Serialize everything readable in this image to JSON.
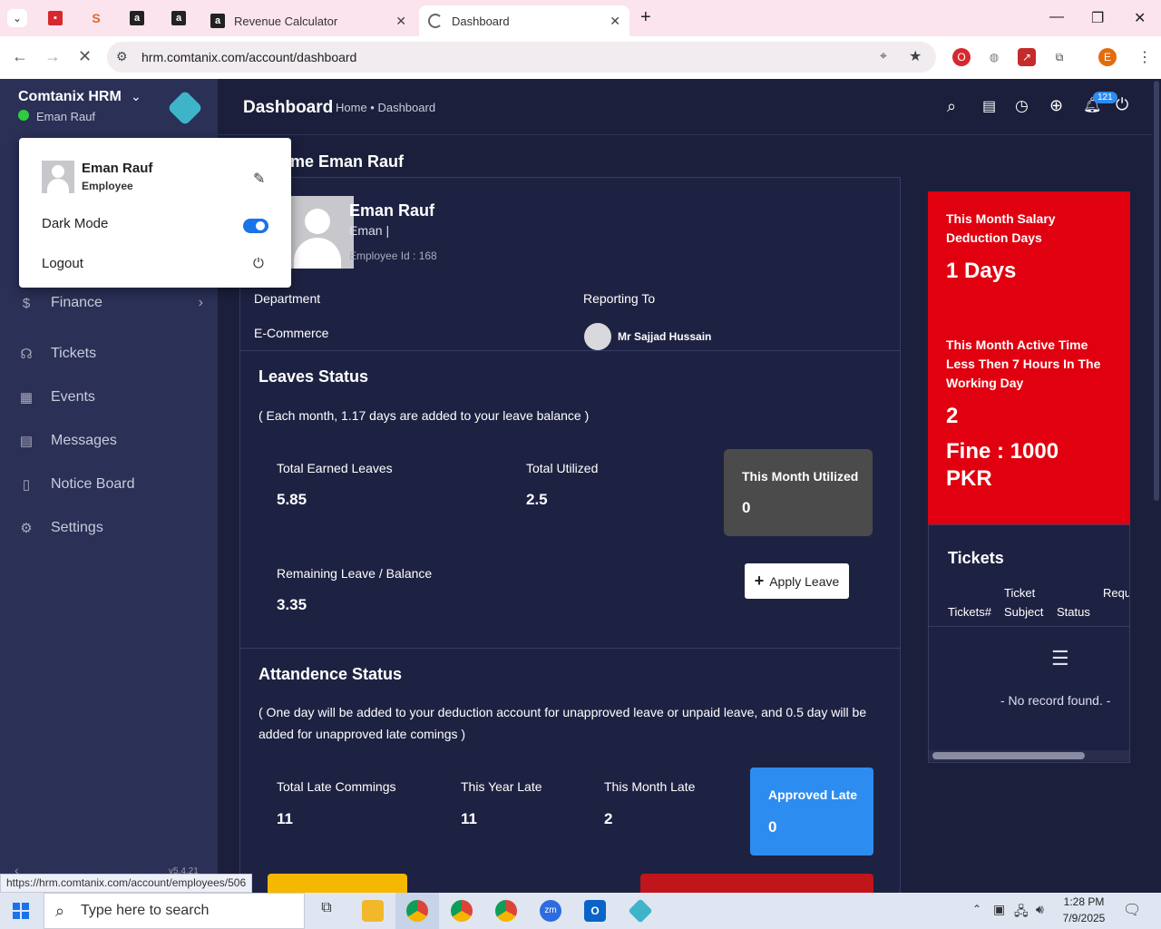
{
  "browser": {
    "tabs": [
      {
        "title": "Revenue Calculator",
        "active": false
      },
      {
        "title": "Dashboard",
        "active": true
      }
    ],
    "url": "hrm.comtanix.com/account/dashboard",
    "status_url": "https://hrm.comtanix.com/account/employees/506",
    "profile_initial": "E",
    "pinned_icons": [
      "red-app-icon",
      "stackby-icon",
      "amazon-a-icon",
      "amazon-a-icon"
    ]
  },
  "app": {
    "brand": "Comtanix HRM",
    "user_name": "Eman Rauf",
    "header_title": "Dashboard",
    "breadcrumb": "Home • Dashboard",
    "notification_count": "121",
    "version": "v5.4.21",
    "sidebar_items": [
      {
        "label": "Finance",
        "icon": "dollar-icon"
      },
      {
        "label": "Tickets",
        "icon": "headset-icon"
      },
      {
        "label": "Events",
        "icon": "calendar-icon"
      },
      {
        "label": "Messages",
        "icon": "message-icon"
      },
      {
        "label": "Notice Board",
        "icon": "clipboard-icon"
      },
      {
        "label": "Settings",
        "icon": "gear-icon"
      }
    ]
  },
  "popup": {
    "name": "Eman Rauf",
    "role": "Employee",
    "dark_mode_label": "Dark Mode",
    "dark_mode_on": true,
    "logout_label": "Logout"
  },
  "welcome": {
    "heading": "me Eman Rauf",
    "name": "Eman Rauf",
    "sub": "Eman |",
    "employee_id": "Employee Id : 168",
    "department_label": "Department",
    "department_value": "E-Commerce",
    "reporting_label": "Reporting To",
    "reporting_value": "Mr Sajjad Hussain"
  },
  "leaves": {
    "title": "Leaves Status",
    "note": "( Each month, 1.17 days are added to your leave balance )",
    "earned_label": "Total Earned Leaves",
    "earned_value": "5.85",
    "utilized_label": "Total Utilized",
    "utilized_value": "2.5",
    "month_label": "This Month Utilized",
    "month_value": "0",
    "remaining_label": "Remaining Leave / Balance",
    "remaining_value": "3.35",
    "apply_label": "Apply Leave"
  },
  "attendance": {
    "title": "Attandence Status",
    "note": "( One day will be added to your deduction account for unapproved leave or unpaid leave, and 0.5 day will be added for unapproved late comings )",
    "late_label": "Total Late Commings",
    "late_value": "11",
    "year_label": "This Year Late",
    "year_value": "11",
    "month_label": "This Month Late",
    "month_value": "2",
    "approved_label": "Approved Late",
    "approved_value": "0"
  },
  "deduction": {
    "salary_label": "This Month Salary Deduction Days",
    "salary_value": "1 Days",
    "active_label": "This Month Active Time Less Then 7 Hours In The Working Day",
    "active_value": "2",
    "fine": "Fine : 1000 PKR"
  },
  "tickets": {
    "title": "Tickets",
    "col1": "Tickets#",
    "col2a": "Ticket",
    "col2b": "Subject",
    "col3": "Status",
    "col4": "Requ",
    "empty": "- No record found. -"
  },
  "taskbar": {
    "search_placeholder": "Type here to search",
    "time": "1:28 PM",
    "date": "7/9/2025"
  }
}
